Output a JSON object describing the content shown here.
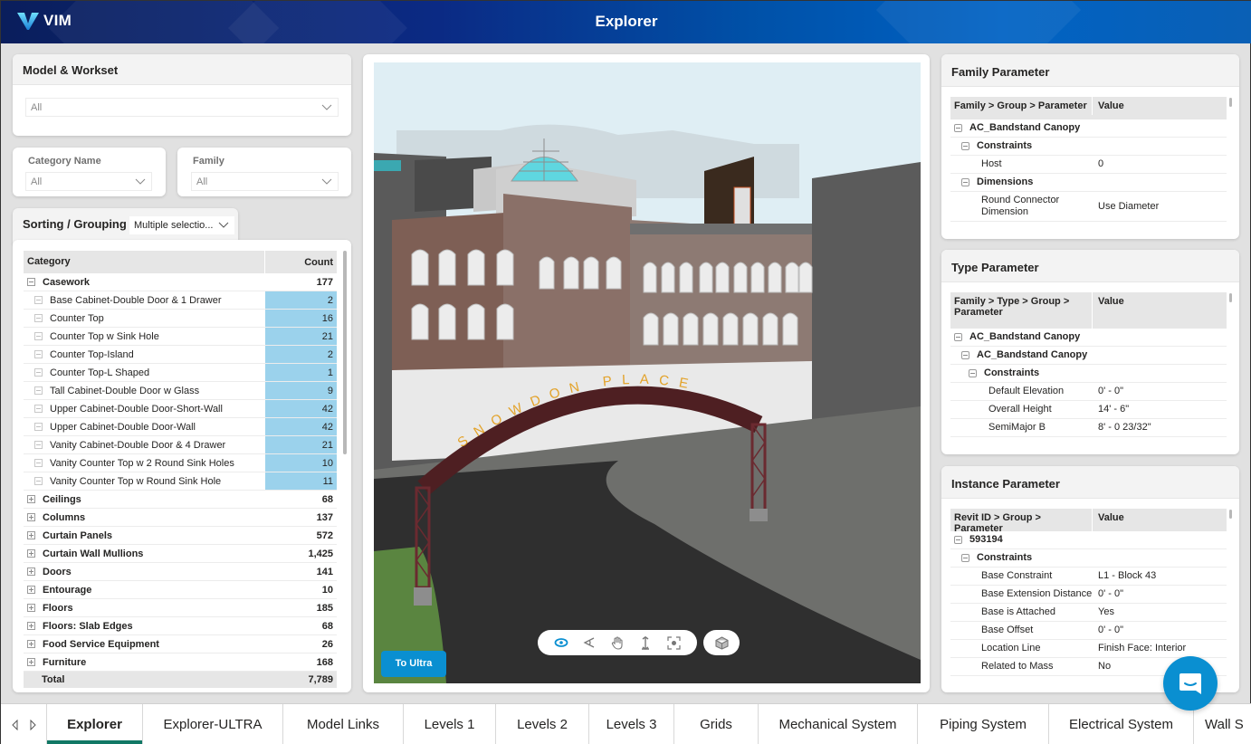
{
  "header": {
    "logo_text": "VIM",
    "title": "Explorer"
  },
  "filters": {
    "model_workset": {
      "title": "Model & Workset",
      "value": "All"
    },
    "category_name": {
      "label": "Category Name",
      "value": "All"
    },
    "family": {
      "label": "Family",
      "value": "All"
    },
    "sorting": {
      "label": "Sorting / Grouping",
      "value": "Multiple selectio..."
    }
  },
  "category_table": {
    "headers": [
      "Category",
      "Count"
    ],
    "rows": [
      {
        "type": "group",
        "expanded": true,
        "name": "Casework",
        "count": "177"
      },
      {
        "type": "child",
        "name": "Base Cabinet-Double Door & 1 Drawer",
        "count": "2"
      },
      {
        "type": "child",
        "name": "Counter Top",
        "count": "16"
      },
      {
        "type": "child",
        "name": "Counter Top w Sink Hole",
        "count": "21"
      },
      {
        "type": "child",
        "name": "Counter Top-Island",
        "count": "2"
      },
      {
        "type": "child",
        "name": "Counter Top-L Shaped",
        "count": "1"
      },
      {
        "type": "child",
        "name": "Tall Cabinet-Double Door w Glass",
        "count": "9"
      },
      {
        "type": "child",
        "name": "Upper Cabinet-Double Door-Short-Wall",
        "count": "42"
      },
      {
        "type": "child",
        "name": "Upper Cabinet-Double Door-Wall",
        "count": "42"
      },
      {
        "type": "child",
        "name": "Vanity Cabinet-Double Door & 4 Drawer",
        "count": "21"
      },
      {
        "type": "child",
        "name": "Vanity Counter Top w 2 Round Sink Holes",
        "count": "10"
      },
      {
        "type": "child",
        "name": "Vanity Counter Top w Round Sink Hole",
        "count": "11"
      },
      {
        "type": "group",
        "expanded": false,
        "name": "Ceilings",
        "count": "68"
      },
      {
        "type": "group",
        "expanded": false,
        "name": "Columns",
        "count": "137"
      },
      {
        "type": "group",
        "expanded": false,
        "name": "Curtain Panels",
        "count": "572"
      },
      {
        "type": "group",
        "expanded": false,
        "name": "Curtain Wall Mullions",
        "count": "1,425"
      },
      {
        "type": "group",
        "expanded": false,
        "name": "Doors",
        "count": "141"
      },
      {
        "type": "group",
        "expanded": false,
        "name": "Entourage",
        "count": "10"
      },
      {
        "type": "group",
        "expanded": false,
        "name": "Floors",
        "count": "185"
      },
      {
        "type": "group",
        "expanded": false,
        "name": "Floors: Slab Edges",
        "count": "68"
      },
      {
        "type": "group",
        "expanded": false,
        "name": "Food Service Equipment",
        "count": "26"
      },
      {
        "type": "group",
        "expanded": false,
        "name": "Furniture",
        "count": "168"
      }
    ],
    "total_label": "Total",
    "total_value": "7,789"
  },
  "viewer": {
    "sign_text": "SNOWDON PLACE",
    "to_ultra_label": "To Ultra",
    "tools": [
      "orbit-icon",
      "look-icon",
      "pan-icon",
      "zoom-icon",
      "focus-icon"
    ],
    "extra_tool": "cube-icon",
    "active_tool": "orbit-icon",
    "accent": "#0a8fd1"
  },
  "family_parameter": {
    "title": "Family Parameter",
    "headers": [
      "Family > Group > Parameter",
      "Value"
    ],
    "rows": [
      {
        "level": 0,
        "group": true,
        "name": "AC_Bandstand Canopy",
        "value": ""
      },
      {
        "level": 1,
        "group": true,
        "name": "Constraints",
        "value": ""
      },
      {
        "level": 1,
        "group": false,
        "name": "Host",
        "value": "0"
      },
      {
        "level": 1,
        "group": true,
        "name": "Dimensions",
        "value": ""
      },
      {
        "level": 1,
        "group": false,
        "name": "Round Connector Dimension",
        "value": "Use Diameter"
      }
    ]
  },
  "type_parameter": {
    "title": "Type Parameter",
    "headers": [
      "Family > Type > Group > Parameter",
      "Value"
    ],
    "rows": [
      {
        "level": 0,
        "group": true,
        "name": "AC_Bandstand Canopy",
        "value": ""
      },
      {
        "level": 1,
        "group": true,
        "name": "AC_Bandstand Canopy",
        "value": ""
      },
      {
        "level": 2,
        "group": true,
        "name": "Constraints",
        "value": ""
      },
      {
        "level": 2,
        "group": false,
        "name": "Default Elevation",
        "value": "0' - 0\""
      },
      {
        "level": 2,
        "group": false,
        "name": "Overall Height",
        "value": "14' - 6\""
      },
      {
        "level": 2,
        "group": false,
        "name": "SemiMajor B",
        "value": "8' - 0 23/32\""
      }
    ]
  },
  "instance_parameter": {
    "title": "Instance Parameter",
    "headers": [
      "Revit ID > Group > Parameter",
      "Value"
    ],
    "rows": [
      {
        "level": 0,
        "group": true,
        "name": "593194",
        "value": ""
      },
      {
        "level": 1,
        "group": true,
        "name": "Constraints",
        "value": ""
      },
      {
        "level": 1,
        "group": false,
        "name": "Base Constraint",
        "value": "L1 - Block 43"
      },
      {
        "level": 1,
        "group": false,
        "name": "Base Extension Distance",
        "value": "0' - 0\""
      },
      {
        "level": 1,
        "group": false,
        "name": "Base is Attached",
        "value": "Yes"
      },
      {
        "level": 1,
        "group": false,
        "name": "Base Offset",
        "value": "0' - 0\""
      },
      {
        "level": 1,
        "group": false,
        "name": "Location Line",
        "value": "Finish Face: Interior"
      },
      {
        "level": 1,
        "group": false,
        "name": "Related to Mass",
        "value": "No"
      }
    ]
  },
  "tabs": [
    {
      "label": "Explorer",
      "active": true
    },
    {
      "label": "Explorer-ULTRA",
      "active": false
    },
    {
      "label": "Model Links",
      "active": false
    },
    {
      "label": "Levels 1",
      "active": false
    },
    {
      "label": "Levels 2",
      "active": false
    },
    {
      "label": "Levels 3",
      "active": false
    },
    {
      "label": "Grids",
      "active": false
    },
    {
      "label": "Mechanical System",
      "active": false
    },
    {
      "label": "Piping System",
      "active": false
    },
    {
      "label": "Electrical System",
      "active": false
    },
    {
      "label": "Wall S",
      "active": false
    }
  ],
  "colors": {
    "header_start": "#0a1e5c",
    "header_end": "#0062c4",
    "count_highlight": "#9bd2ec",
    "active_tab": "#117865",
    "chat_button": "#0a8fd1"
  }
}
